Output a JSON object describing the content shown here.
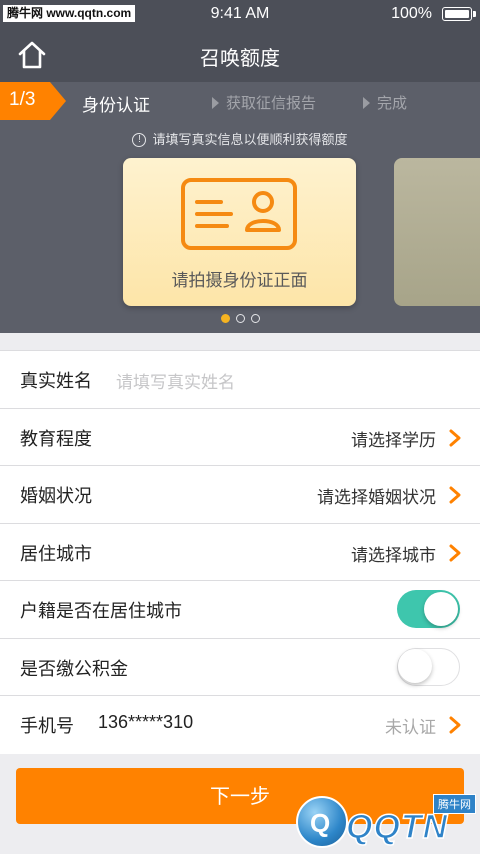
{
  "status_bar": {
    "watermark": "腾牛网 www.qqtn.com",
    "time": "9:41 AM",
    "battery": "100%"
  },
  "nav": {
    "title": "召唤额度",
    "home_icon": "home-icon"
  },
  "steps": {
    "progress": "1/3",
    "current": "身份认证",
    "next1": "获取征信报告",
    "next2": "完成"
  },
  "banner": {
    "tip": "请填写真实信息以便顺利获得额度",
    "card_label": "请拍摄身份证正面",
    "active_dot": 0,
    "dot_count": 3
  },
  "form": {
    "name": {
      "label": "真实姓名",
      "placeholder": "请填写真实姓名"
    },
    "education": {
      "label": "教育程度",
      "value": "请选择学历"
    },
    "marital": {
      "label": "婚姻状况",
      "value": "请选择婚姻状况"
    },
    "city": {
      "label": "居住城市",
      "value": "请选择城市"
    },
    "hukou": {
      "label": "户籍是否在居住城市",
      "on": true
    },
    "fund": {
      "label": "是否缴公积金",
      "on": false
    },
    "phone": {
      "label": "手机号",
      "number": "136*****310",
      "status": "未认证"
    }
  },
  "next_button": "下一步",
  "watermark_bottom": {
    "brand": "QQTN",
    "sub": "腾牛网"
  },
  "colors": {
    "header": "#4c4f58",
    "accent_orange": "#ff8200",
    "toggle_on": "#3ec6ad"
  }
}
